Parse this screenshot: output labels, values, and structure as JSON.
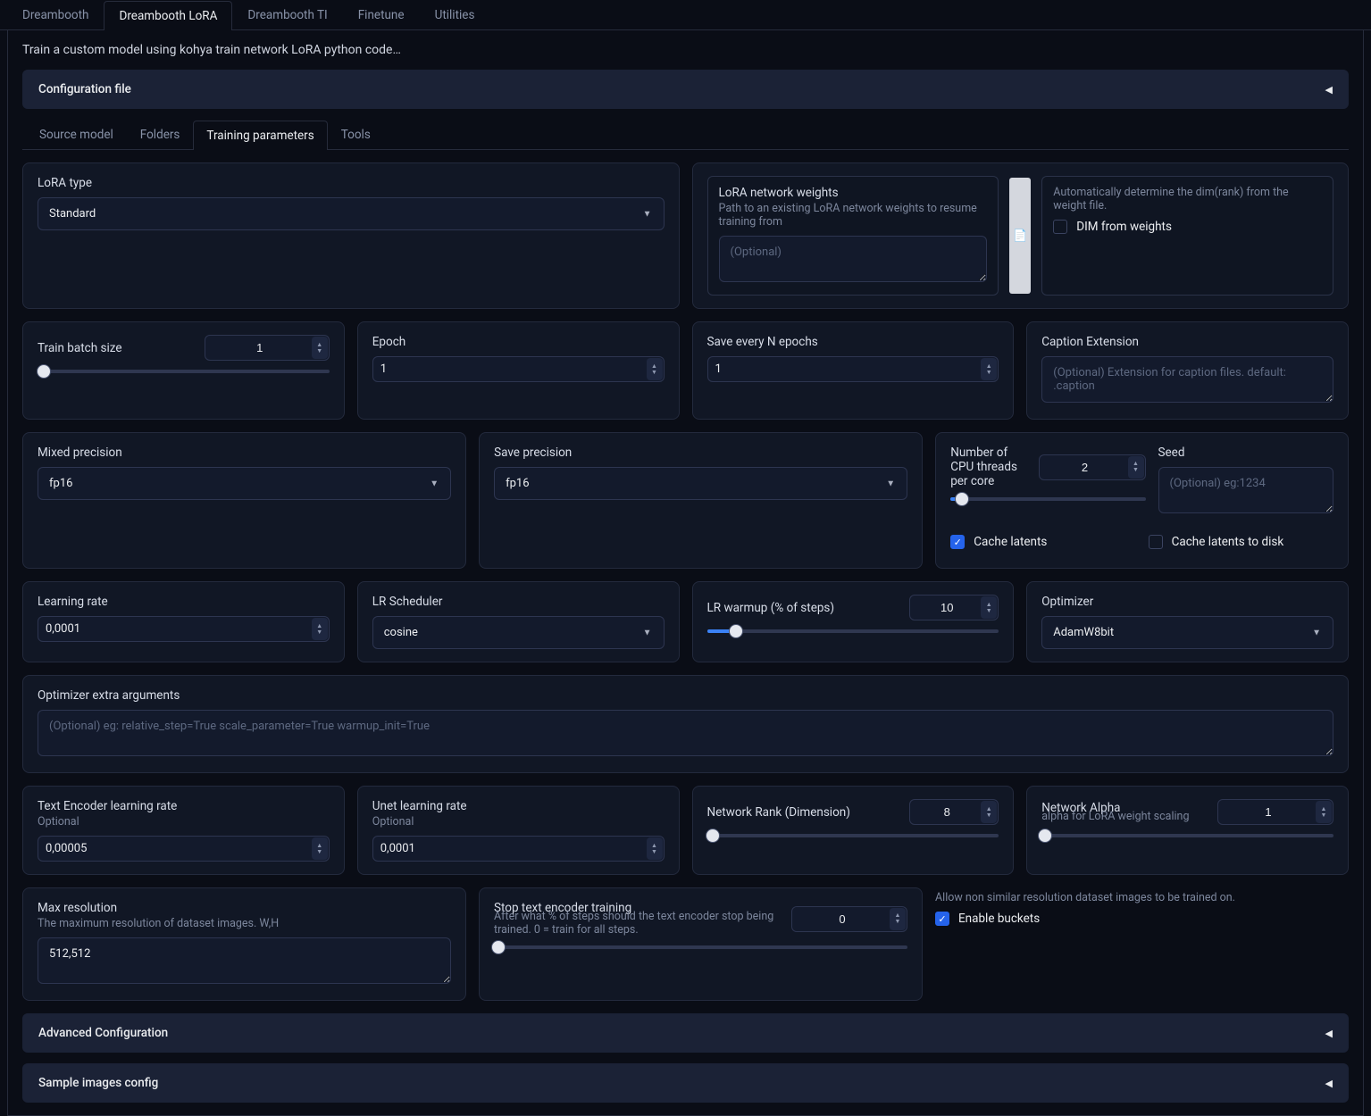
{
  "top_tabs": {
    "dreambooth": "Dreambooth",
    "dreambooth_lora": "Dreambooth LoRA",
    "dreambooth_ti": "Dreambooth TI",
    "finetune": "Finetune",
    "utilities": "Utilities"
  },
  "subtitle": "Train a custom model using kohya train network LoRA python code…",
  "config_file": {
    "title": "Configuration file"
  },
  "sub_tabs": {
    "source_model": "Source model",
    "folders": "Folders",
    "training_parameters": "Training parameters",
    "tools": "Tools"
  },
  "lora_type": {
    "label": "LoRA type",
    "value": "Standard"
  },
  "lora_weights": {
    "label": "LoRA network weights",
    "help": "Path to an existing LoRA network weights to resume training from",
    "placeholder": "(Optional)"
  },
  "dim_from_weights": {
    "help": "Automatically determine the dim(rank) from the weight file.",
    "label": "DIM from weights"
  },
  "train_batch": {
    "label": "Train batch size",
    "value": "1"
  },
  "epoch": {
    "label": "Epoch",
    "value": "1"
  },
  "save_n": {
    "label": "Save every N epochs",
    "value": "1"
  },
  "caption_ext": {
    "label": "Caption Extension",
    "placeholder": "(Optional) Extension for caption files. default: .caption"
  },
  "mixed_precision": {
    "label": "Mixed precision",
    "value": "fp16"
  },
  "save_precision": {
    "label": "Save precision",
    "value": "fp16"
  },
  "cpu_threads": {
    "label": "Number of CPU threads per core",
    "value": "2"
  },
  "seed": {
    "label": "Seed",
    "placeholder": "(Optional) eg:1234"
  },
  "cache_latents": {
    "label": "Cache latents"
  },
  "cache_latents_disk": {
    "label": "Cache latents to disk"
  },
  "learning_rate": {
    "label": "Learning rate",
    "value": "0,0001"
  },
  "lr_scheduler": {
    "label": "LR Scheduler",
    "value": "cosine"
  },
  "lr_warmup": {
    "label": "LR warmup (% of steps)",
    "value": "10"
  },
  "optimizer": {
    "label": "Optimizer",
    "value": "AdamW8bit"
  },
  "optimizer_args": {
    "label": "Optimizer extra arguments",
    "placeholder": "(Optional) eg: relative_step=True scale_parameter=True warmup_init=True"
  },
  "te_lr": {
    "label": "Text Encoder learning rate",
    "sublabel": "Optional",
    "value": "0,00005"
  },
  "unet_lr": {
    "label": "Unet learning rate",
    "sublabel": "Optional",
    "value": "0,0001"
  },
  "net_rank": {
    "label": "Network Rank (Dimension)",
    "value": "8"
  },
  "net_alpha": {
    "label": "Network Alpha",
    "sublabel": "alpha for LoRA weight scaling",
    "value": "1"
  },
  "max_res": {
    "label": "Max resolution",
    "sublabel": "The maximum resolution of dataset images. W,H",
    "value": "512,512"
  },
  "stop_te": {
    "label": "Stop text encoder training",
    "sublabel": "After what % of steps should the text encoder stop being trained. 0 = train for all steps.",
    "value": "0"
  },
  "enable_buckets": {
    "help": "Allow non similar resolution dataset images to be trained on.",
    "label": "Enable buckets"
  },
  "adv_config": {
    "title": "Advanced Configuration"
  },
  "sample_config": {
    "title": "Sample images config"
  }
}
